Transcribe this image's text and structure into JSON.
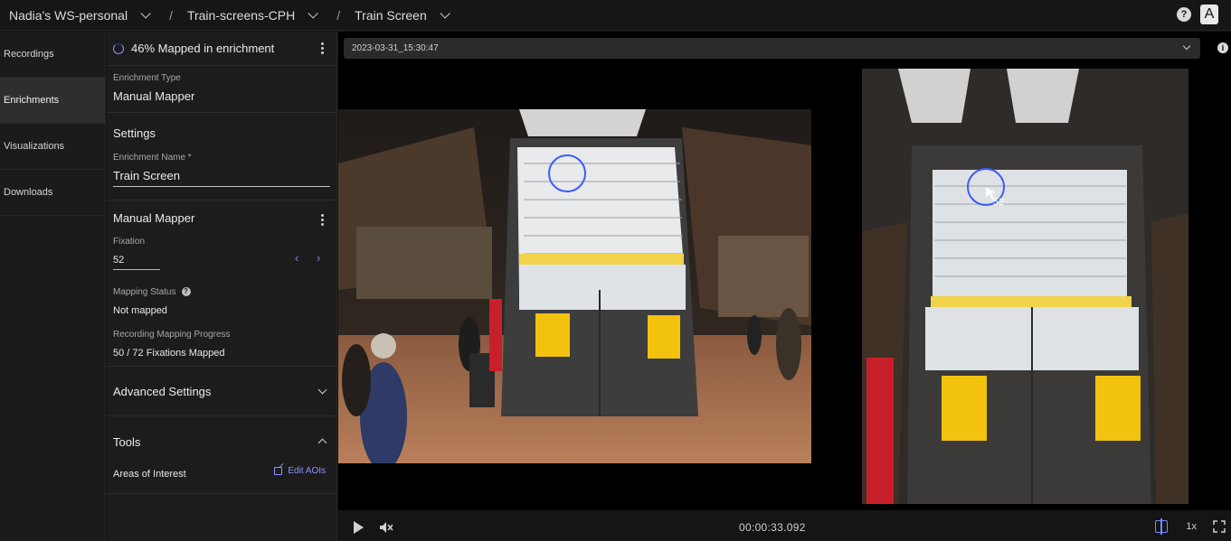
{
  "breadcrumbs": [
    "Nadia's WS-personal",
    "Train-screens-CPH",
    "Train Screen"
  ],
  "breadcrumb_separator": "/",
  "topbar": {
    "help_symbol": "?",
    "avatar_initial": "A"
  },
  "nav": {
    "items": [
      {
        "label": "Recordings",
        "active": false
      },
      {
        "label": "Enrichments",
        "active": true
      },
      {
        "label": "Visualizations",
        "active": false
      },
      {
        "label": "Downloads",
        "active": false
      }
    ]
  },
  "panel": {
    "status": "46% Mapped in enrichment",
    "enrichment_type_label": "Enrichment Type",
    "enrichment_type_value": "Manual Mapper",
    "settings_title": "Settings",
    "name_label": "Enrichment Name *",
    "name_value": "Train Screen",
    "mapper_title": "Manual Mapper",
    "fixation_label": "Fixation",
    "fixation_value": "52",
    "prev_arrow": "‹",
    "next_arrow": "›",
    "mapping_status_label": "Mapping Status",
    "mapping_status_value": "Not mapped",
    "progress_label": "Recording Mapping Progress",
    "progress_value": "50 / 72 Fixations Mapped",
    "advanced_title": "Advanced Settings",
    "tools_title": "Tools",
    "aoi_label": "Areas of Interest",
    "edit_aoi_label": "Edit AOIs"
  },
  "player": {
    "recording": "2023-03-31_15:30:47",
    "info_symbol": "i",
    "fixation_marker": "52",
    "timecode": "00:00:33.092",
    "speed": "1x"
  },
  "colors": {
    "accent": "#7d83ff",
    "gaze_circle": "#3b5cff"
  }
}
